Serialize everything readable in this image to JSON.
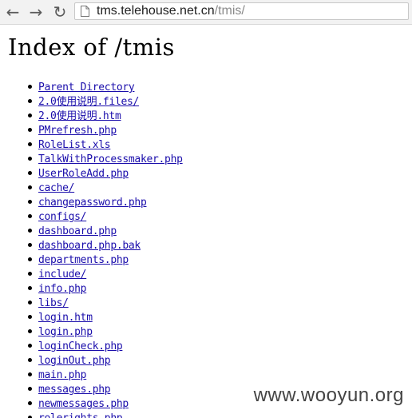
{
  "browser": {
    "url_host": "tms.telehouse.net.cn",
    "url_path": "/tmis/",
    "back_icon": "back-arrow-icon",
    "forward_icon": "forward-arrow-icon",
    "reload_icon": "reload-icon",
    "page_icon": "page-icon"
  },
  "page": {
    "title": "Index of /tmis",
    "entries": [
      "Parent Directory",
      "2.0使用说明.files/",
      "2.0使用说明.htm",
      "PMrefresh.php",
      "RoleList.xls",
      "TalkWithProcessmaker.php",
      "UserRoleAdd.php",
      "cache/",
      "changepassword.php",
      "configs/",
      "dashboard.php",
      "dashboard.php.bak",
      "departments.php",
      "include/",
      "info.php",
      "libs/",
      "login.htm",
      "login.php",
      "loginCheck.php",
      "loginOut.php",
      "main.php",
      "messages.php",
      "newmessages.php",
      "rolerights.php"
    ]
  },
  "watermark": "www.wooyun.org"
}
